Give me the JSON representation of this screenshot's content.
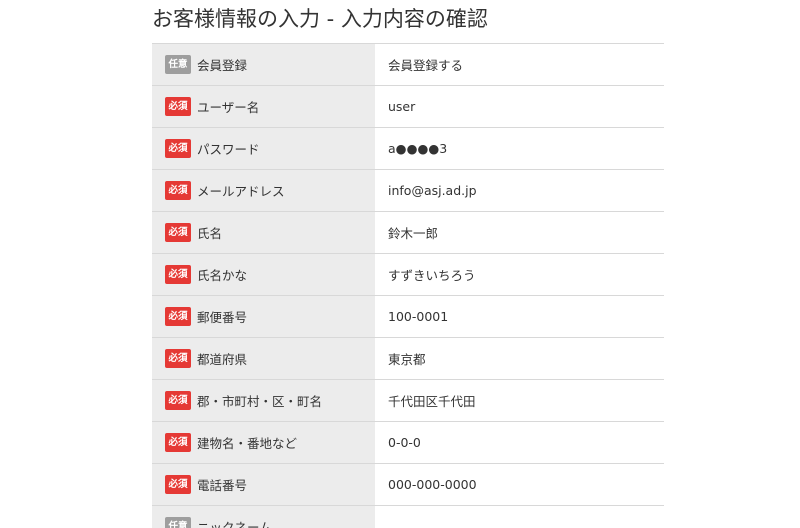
{
  "page": {
    "title": "お客様情報の入力 - 入力内容の確認"
  },
  "colors": {
    "required_badge": "#e53935",
    "optional_badge": "#9e9e9e",
    "label_background": "#ececec",
    "border": "#d8d8d8"
  },
  "rows": [
    {
      "badge": "任意",
      "badge_type": "optional",
      "label": "会員登録",
      "value": "会員登録する"
    },
    {
      "badge": "必須",
      "badge_type": "required",
      "label": "ユーザー名",
      "value": "user"
    },
    {
      "badge": "必須",
      "badge_type": "required",
      "label": "パスワード",
      "value": "a●●●●3"
    },
    {
      "badge": "必須",
      "badge_type": "required",
      "label": "メールアドレス",
      "value": "info@asj.ad.jp"
    },
    {
      "badge": "必須",
      "badge_type": "required",
      "label": "氏名",
      "value": "鈴木一郎"
    },
    {
      "badge": "必須",
      "badge_type": "required",
      "label": "氏名かな",
      "value": "すずきいちろう"
    },
    {
      "badge": "必須",
      "badge_type": "required",
      "label": "郵便番号",
      "value": "100-0001"
    },
    {
      "badge": "必須",
      "badge_type": "required",
      "label": "都道府県",
      "value": "東京都"
    },
    {
      "badge": "必須",
      "badge_type": "required",
      "label": "郡・市町村・区・町名",
      "value": "千代田区千代田"
    },
    {
      "badge": "必須",
      "badge_type": "required",
      "label": "建物名・番地など",
      "value": "0-0-0"
    },
    {
      "badge": "必須",
      "badge_type": "required",
      "label": "電話番号",
      "value": "000-000-0000"
    },
    {
      "badge": "任意",
      "badge_type": "optional",
      "label": "ニックネーム",
      "value": ""
    }
  ]
}
